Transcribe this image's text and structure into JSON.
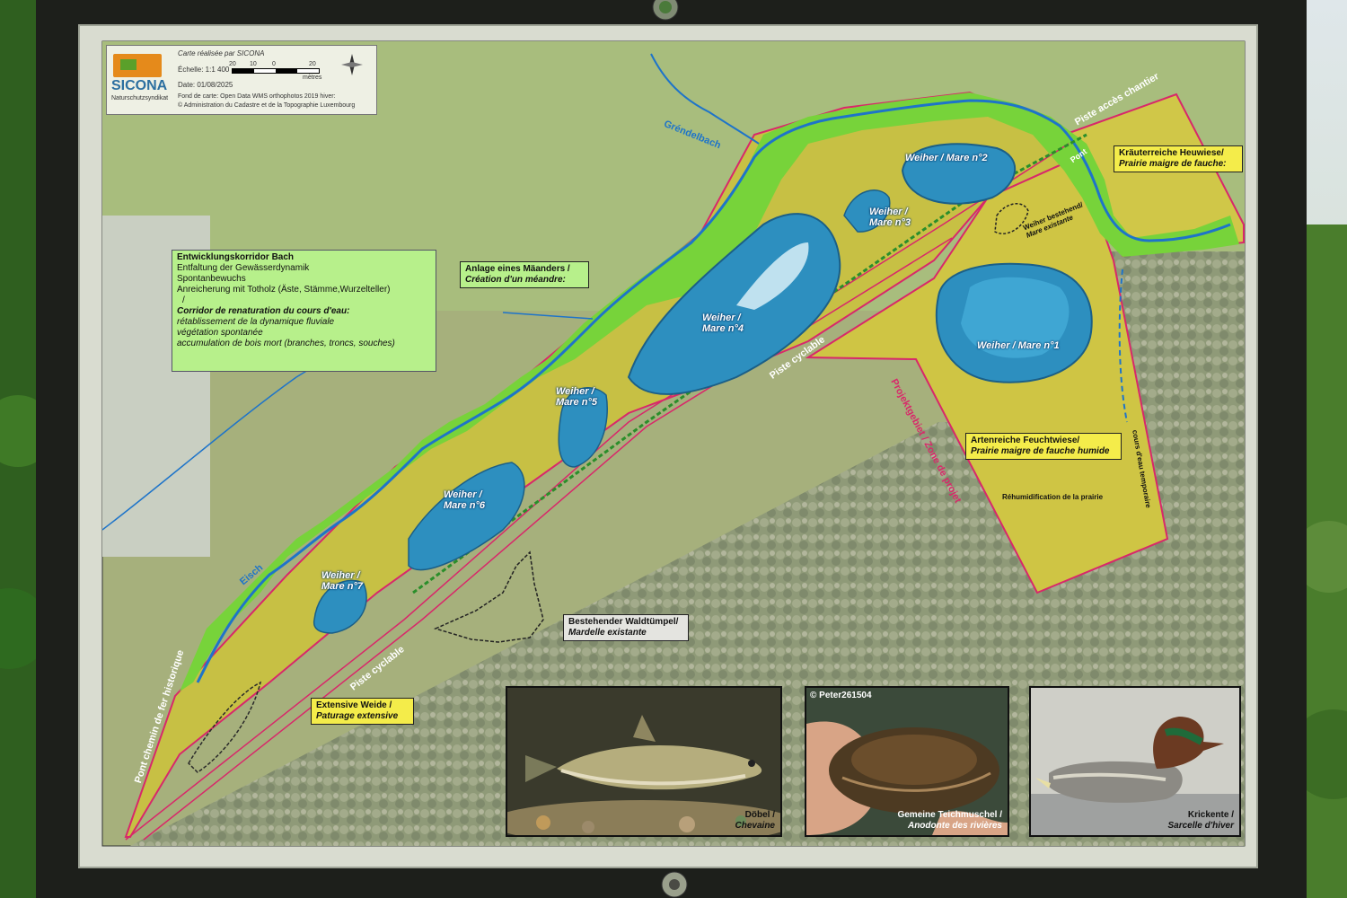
{
  "header": {
    "credit": "Carte réalisée par SICONA",
    "scale": "Échelle: 1:1 400",
    "scale_ticks": [
      "20",
      "10",
      "0",
      "20"
    ],
    "scale_unit": "mètres",
    "date": "Date: 01/08/2025",
    "basemap_1": "Fond de carte: Open Data WMS orthophotos 2019 hiver:",
    "basemap_2": "© Administration du Cadastre et de la Topographie Luxembourg",
    "logo_text": "SICONA",
    "logo_sub": "Naturschutzsyndikat"
  },
  "rivers": {
    "grendelbach": "Gréndelbach",
    "eisch": "Eisch",
    "temporary": "cours d'eau temporaire"
  },
  "paths": {
    "access": "Piste accès chantier",
    "pont": "Pont",
    "cycle_1": "Piste cyclable",
    "cycle_2": "Piste cyclable",
    "rail_bridge": "Pont chemin de fer historique",
    "project": "Projektgebiet / Zone de projet"
  },
  "ponds": [
    {
      "de": "Weiher / ",
      "fr": "Mare  n°1"
    },
    {
      "de": "Weiher / ",
      "fr": "Mare  n°2"
    },
    {
      "de": "Weiher / ",
      "fr": "Mare  n°3"
    },
    {
      "de": "Weiher / ",
      "fr": "Mare  n°4"
    },
    {
      "de": "Weiher / ",
      "fr": "Mare  n°5"
    },
    {
      "de": "Weiher / ",
      "fr": "Mare  n°6"
    },
    {
      "de": "Weiher / ",
      "fr": "Mare  n°7"
    }
  ],
  "existing_pond": {
    "de": "Weiher bestehend/",
    "fr": "Mare existante"
  },
  "rewetting": "Réhumidification de la prairie",
  "corridor": {
    "title": "Entwicklungskorridor Bach",
    "lines_de": [
      "Entfaltung der Gewässerdynamik",
      "Spontanbewuchs",
      "Anreicherung mit Totholz (Äste, Stämme,Wurzelteller)",
      "/"
    ],
    "title_fr": "Corridor de renaturation du cours d'eau:",
    "lines_fr": [
      "rétablissement de la dynamique fluviale",
      "végétation spontanée",
      "accumulation de bois mort (branches, troncs, souches)"
    ]
  },
  "meander": {
    "de": "Anlage eines Mäanders /",
    "fr": "Création d'un méandre:"
  },
  "herb_meadow": {
    "de": "Kräuterreiche Heuwiese/",
    "fr": "Prairie maigre de fauche:"
  },
  "wet_meadow": {
    "de": "Artenreiche Feuchtwiese/",
    "fr": "Prairie maigre de fauche humide"
  },
  "forest_pond": {
    "de": "Bestehender Waldtümpel/",
    "fr": "Mardelle existante"
  },
  "pasture": {
    "de": "Extensive Weide /",
    "fr": "Paturage extensive"
  },
  "photos": [
    {
      "de": "Döbel /",
      "fr": "Chevaine",
      "icon": "fish-icon"
    },
    {
      "de": "Gemeine Teichmuschel /",
      "fr": "Anodonte des rivières",
      "credit": "© Peter261504",
      "icon": "mussel-icon"
    },
    {
      "de": "Krickente /",
      "fr": "Sarcelle d'hiver",
      "icon": "duck-icon"
    }
  ],
  "colors": {
    "corridor": "#7cd43a",
    "meadow": "#c9c449",
    "pond": "#2d8fbf",
    "boundary": "#d8286a",
    "river": "#1e74c9"
  }
}
